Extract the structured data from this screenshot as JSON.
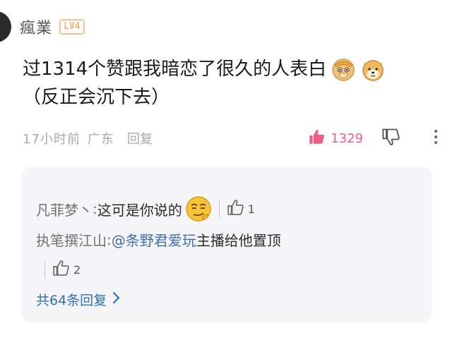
{
  "comment": {
    "username": "瘋業",
    "level": "LV4",
    "text_line1": "过1314个赞跟我暗恋了很久的人表白",
    "text_line2": "（反正会沉下去）",
    "emojis": [
      "monkey-king-face",
      "shiba-dog-face"
    ],
    "time": "17小时前",
    "location": "广东",
    "reply_label": "回复",
    "likes": "1329",
    "colors": {
      "like": "#e95f86",
      "mention": "#3f6fb0",
      "panel_bg": "#f5f5f7"
    }
  },
  "replies": [
    {
      "author": "凡菲梦丶",
      "separator": ":",
      "text": "这可是你说的",
      "emoji": "smirk-face",
      "likes": "1"
    },
    {
      "author": "执笔撰江山",
      "separator": ":",
      "mention": "@条野君爱玩",
      "text": " 主播给他置顶",
      "likes": "2"
    }
  ],
  "all_replies_label": "共64条回复",
  "icons": [
    "thumbs-up-icon",
    "thumbs-down-icon",
    "more-dots-icon",
    "chevron-right-icon"
  ]
}
